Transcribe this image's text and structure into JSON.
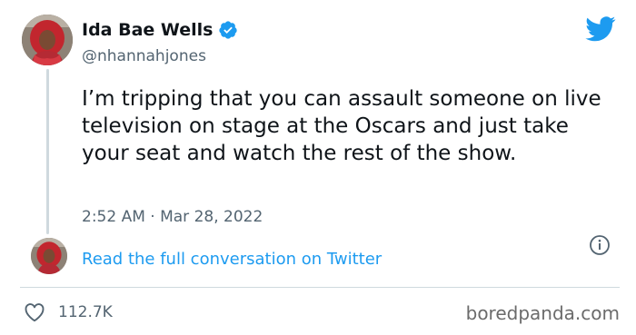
{
  "tweet": {
    "display_name": "Ida Bae Wells",
    "handle": "@nhannahjones",
    "text": "I’m tripping that you can assault someone on live television on stage at the Oscars and just take your seat and watch the rest of the show.",
    "timestamp": "2:52 AM · Mar 28, 2022",
    "read_more": "Read the full conversation on Twitter",
    "likes": "112.7K"
  },
  "watermark": "boredpanda.com",
  "icons": {
    "verified": "verified-badge-icon",
    "brand": "twitter-bird-icon",
    "info": "info-icon",
    "like": "heart-icon"
  },
  "colors": {
    "accent": "#1d9bf0",
    "secondary_text": "#536471",
    "primary_text": "#0f1419",
    "divider": "#cfd9de"
  }
}
